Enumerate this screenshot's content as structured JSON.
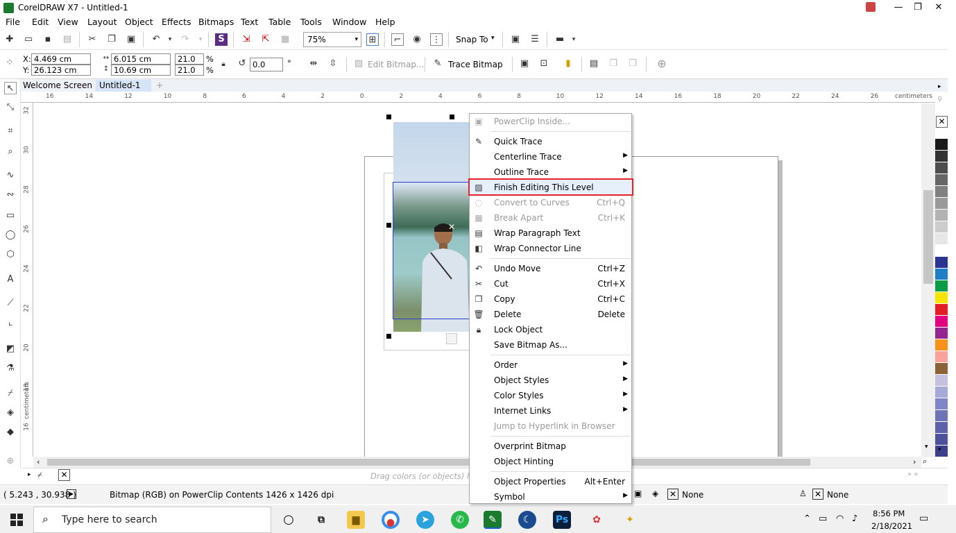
{
  "window": {
    "title": "CorelDRAW X7 - Untitled-1",
    "minimize": "—",
    "restore": "❐",
    "close": "✕"
  },
  "menus": [
    "File",
    "Edit",
    "View",
    "Layout",
    "Object",
    "Effects",
    "Bitmaps",
    "Text",
    "Table",
    "Tools",
    "Window",
    "Help"
  ],
  "toolbar": {
    "zoom": "75%",
    "snap": "Snap To",
    "edit_bitmap": "Edit Bitmap...",
    "trace_bitmap": "Trace Bitmap"
  },
  "props": {
    "x": "4.469 cm",
    "y": "26.123 cm",
    "w": "6.015 cm",
    "h": "10.69 cm",
    "sx": "21.0",
    "sy": "21.0",
    "pct": "%",
    "angle": "0.0",
    "deg": "°",
    "xl": "X:",
    "yl": "Y:"
  },
  "tabs": [
    "Welcome Screen",
    "Untitled-1"
  ],
  "ruler": {
    "unit": "centimeters",
    "h_labels": [
      "16",
      "14",
      "12",
      "10",
      "8",
      "6",
      "4",
      "2",
      "0",
      "2",
      "4",
      "6",
      "8",
      "10",
      "12",
      "14",
      "16",
      "18",
      "20",
      "22",
      "24",
      "26"
    ],
    "v_labels": [
      "32",
      "30",
      "28",
      "26",
      "24",
      "22",
      "20",
      "18",
      "16"
    ]
  },
  "context_menu": {
    "items": [
      {
        "label": "PowerClip Inside...",
        "shortcut": "",
        "disabled": true,
        "submenu": false,
        "icon": "powerclip-icon"
      },
      {
        "sep": true
      },
      {
        "label": "Quick Trace",
        "shortcut": "",
        "disabled": false,
        "submenu": false,
        "icon": "quick-trace-icon"
      },
      {
        "label": "Centerline Trace",
        "shortcut": "",
        "disabled": false,
        "submenu": true,
        "icon": ""
      },
      {
        "label": "Outline Trace",
        "shortcut": "",
        "disabled": false,
        "submenu": true,
        "icon": ""
      },
      {
        "label": "Finish Editing This Level",
        "shortcut": "",
        "disabled": false,
        "submenu": false,
        "icon": "finish-editing-icon",
        "highlighted": true
      },
      {
        "label": "Convert to Curves",
        "shortcut": "Ctrl+Q",
        "disabled": true,
        "submenu": false,
        "icon": "convert-curves-icon"
      },
      {
        "label": "Break Apart",
        "shortcut": "Ctrl+K",
        "disabled": true,
        "submenu": false,
        "icon": "break-apart-icon"
      },
      {
        "label": "Wrap Paragraph Text",
        "shortcut": "",
        "disabled": false,
        "submenu": false,
        "icon": "wrap-text-icon"
      },
      {
        "label": "Wrap Connector Line",
        "shortcut": "",
        "disabled": false,
        "submenu": false,
        "icon": "wrap-connector-icon"
      },
      {
        "sep": true
      },
      {
        "label": "Undo Move",
        "shortcut": "Ctrl+Z",
        "disabled": false,
        "submenu": false,
        "icon": "undo-icon"
      },
      {
        "label": "Cut",
        "shortcut": "Ctrl+X",
        "disabled": false,
        "submenu": false,
        "icon": "scissors-icon"
      },
      {
        "label": "Copy",
        "shortcut": "Ctrl+C",
        "disabled": false,
        "submenu": false,
        "icon": "copy-icon"
      },
      {
        "label": "Delete",
        "shortcut": "Delete",
        "disabled": false,
        "submenu": false,
        "icon": "trash-icon"
      },
      {
        "label": "Lock Object",
        "shortcut": "",
        "disabled": false,
        "submenu": false,
        "icon": "lock-icon"
      },
      {
        "label": "Save Bitmap As...",
        "shortcut": "",
        "disabled": false,
        "submenu": false,
        "icon": ""
      },
      {
        "sep": true
      },
      {
        "label": "Order",
        "shortcut": "",
        "disabled": false,
        "submenu": true,
        "icon": ""
      },
      {
        "label": "Object Styles",
        "shortcut": "",
        "disabled": false,
        "submenu": true,
        "icon": ""
      },
      {
        "label": "Color Styles",
        "shortcut": "",
        "disabled": false,
        "submenu": true,
        "icon": ""
      },
      {
        "label": "Internet Links",
        "shortcut": "",
        "disabled": false,
        "submenu": true,
        "icon": ""
      },
      {
        "label": "Jump to Hyperlink in Browser",
        "shortcut": "",
        "disabled": true,
        "submenu": false,
        "icon": ""
      },
      {
        "sep": true
      },
      {
        "label": "Overprint Bitmap",
        "shortcut": "",
        "disabled": false,
        "submenu": false,
        "icon": ""
      },
      {
        "label": "Object Hinting",
        "shortcut": "",
        "disabled": false,
        "submenu": false,
        "icon": ""
      },
      {
        "sep": true
      },
      {
        "label": "Object Properties",
        "shortcut": "Alt+Enter",
        "disabled": false,
        "submenu": false,
        "icon": ""
      },
      {
        "label": "Symbol",
        "shortcut": "",
        "disabled": false,
        "submenu": true,
        "icon": ""
      }
    ]
  },
  "status": {
    "hint": "Drag colors (or objects) here",
    "coords": "( 5.243 , 30.938 )",
    "info": "Bitmap (RGB) on PowerClip Contents 1426 x 1426 dpi",
    "fill": "None",
    "outline": "None"
  },
  "taskbar": {
    "search": "Type here to search",
    "time": "8:56 PM",
    "date": "2/18/2021"
  },
  "palette": [
    "#ffffff",
    "#1a1a1a",
    "#333333",
    "#4d4d4d",
    "#666666",
    "#7f7f7f",
    "#999999",
    "#b3b3b3",
    "#cccccc",
    "#e6e6e6",
    "#ffffff",
    "#2b3590",
    "#1f7fc4",
    "#0a9c48",
    "#f5e400",
    "#e31e24",
    "#e3007f",
    "#93278f",
    "#f7931d",
    "#f7a29b",
    "#8c6239",
    "#c4c0de",
    "#a7a9d6",
    "#7e86c6",
    "#6e74b6",
    "#5d62a8",
    "#4c5199",
    "#3b3f8a"
  ],
  "colors": {
    "highlight_border": "#e8212a",
    "accent": "#1a7a2e"
  }
}
